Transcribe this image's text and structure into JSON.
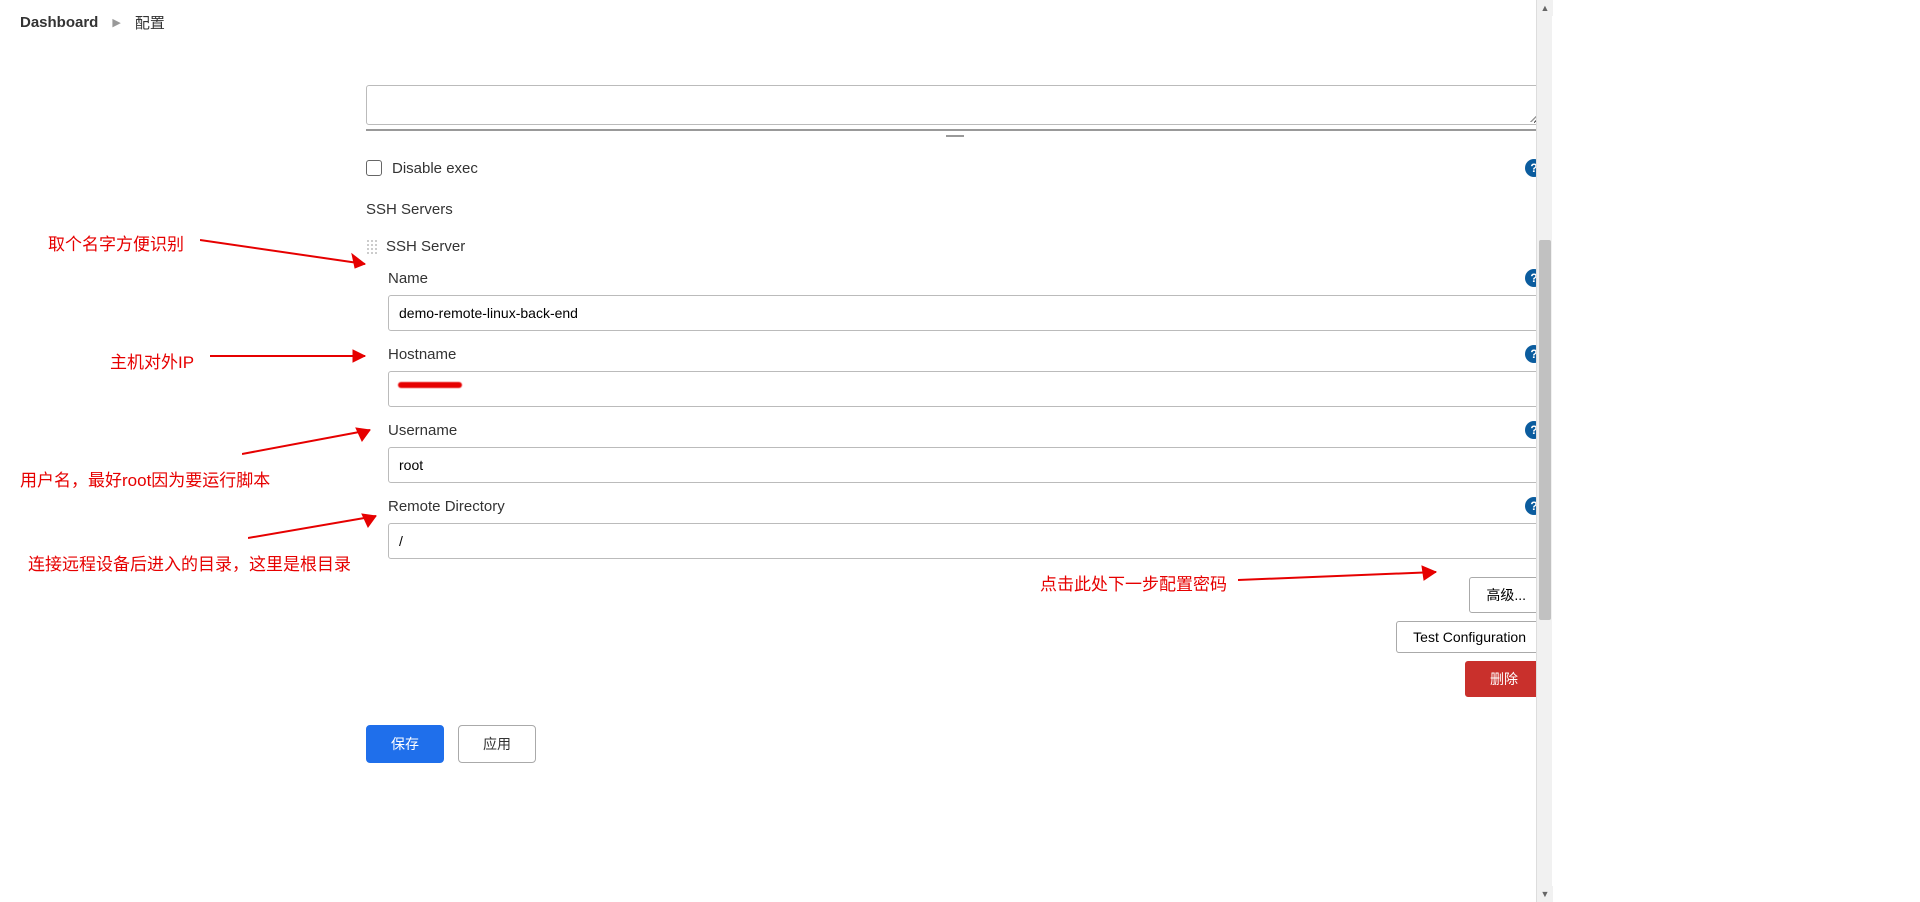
{
  "breadcrumb": {
    "home": "Dashboard",
    "current": "配置"
  },
  "checkbox": {
    "label": "Disable exec"
  },
  "ssh": {
    "section_title": "SSH Servers",
    "item_title": "SSH Server",
    "name_label": "Name",
    "name_value": "demo-remote-linux-back-end",
    "hostname_label": "Hostname",
    "hostname_value": "",
    "username_label": "Username",
    "username_value": "root",
    "remote_dir_label": "Remote Directory",
    "remote_dir_value": "/"
  },
  "buttons": {
    "advanced": "高级...",
    "test_config": "Test Configuration",
    "delete": "删除",
    "save": "保存",
    "apply": "应用"
  },
  "annotations": {
    "name_tip": "取个名字方便识别",
    "hostname_tip": "主机对外IP",
    "username_tip": "用户名，最好root因为要运行脚本",
    "remote_tip": "连接远程设备后进入的目录，这里是根目录",
    "advanced_tip": "点击此处下一步配置密码"
  }
}
